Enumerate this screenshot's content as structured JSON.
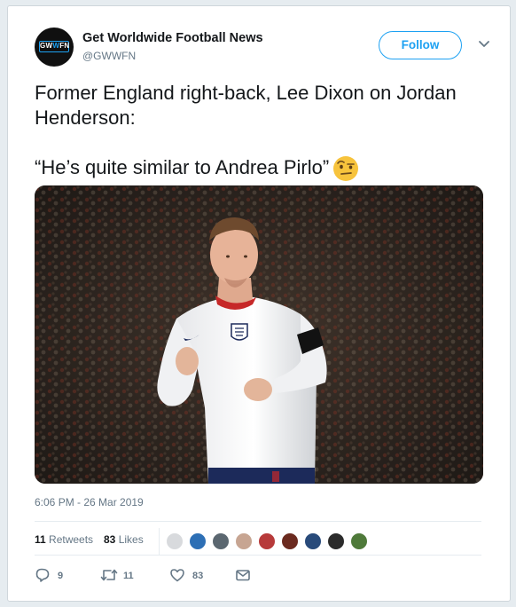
{
  "tweet": {
    "author": {
      "display_name": "Get Worldwide Football News",
      "handle": "@GWWFN",
      "avatar_text_left": "GW",
      "avatar_text_mid": "W",
      "avatar_text_right": "FN"
    },
    "follow_label": "Follow",
    "text_line1": "Former England right-back, Lee Dixon on Jordan Henderson:",
    "text_line2": "“He’s quite similar to Andrea Pirlo”",
    "timestamp": "6:06 PM - 26 Mar 2019",
    "stats": {
      "retweets_count": "11",
      "retweets_label": "Retweets",
      "likes_count": "83",
      "likes_label": "Likes"
    },
    "likers": [
      {
        "icon": "avatar-1",
        "color": "#d8dadd"
      },
      {
        "icon": "avatar-2",
        "color": "#2d6fb5"
      },
      {
        "icon": "avatar-3",
        "color": "#5b6770"
      },
      {
        "icon": "avatar-4",
        "color": "#c7a592"
      },
      {
        "icon": "avatar-5",
        "color": "#b73a3a"
      },
      {
        "icon": "avatar-6",
        "color": "#6b2a1f"
      },
      {
        "icon": "avatar-7",
        "color": "#284a7a"
      },
      {
        "icon": "avatar-8",
        "color": "#2b2b2b"
      },
      {
        "icon": "avatar-9",
        "color": "#4f7a3a"
      }
    ],
    "actions": {
      "replies": "9",
      "retweets": "11",
      "likes": "83"
    }
  },
  "colors": {
    "accent": "#1da1f2",
    "text": "#14171a",
    "muted": "#657786"
  }
}
